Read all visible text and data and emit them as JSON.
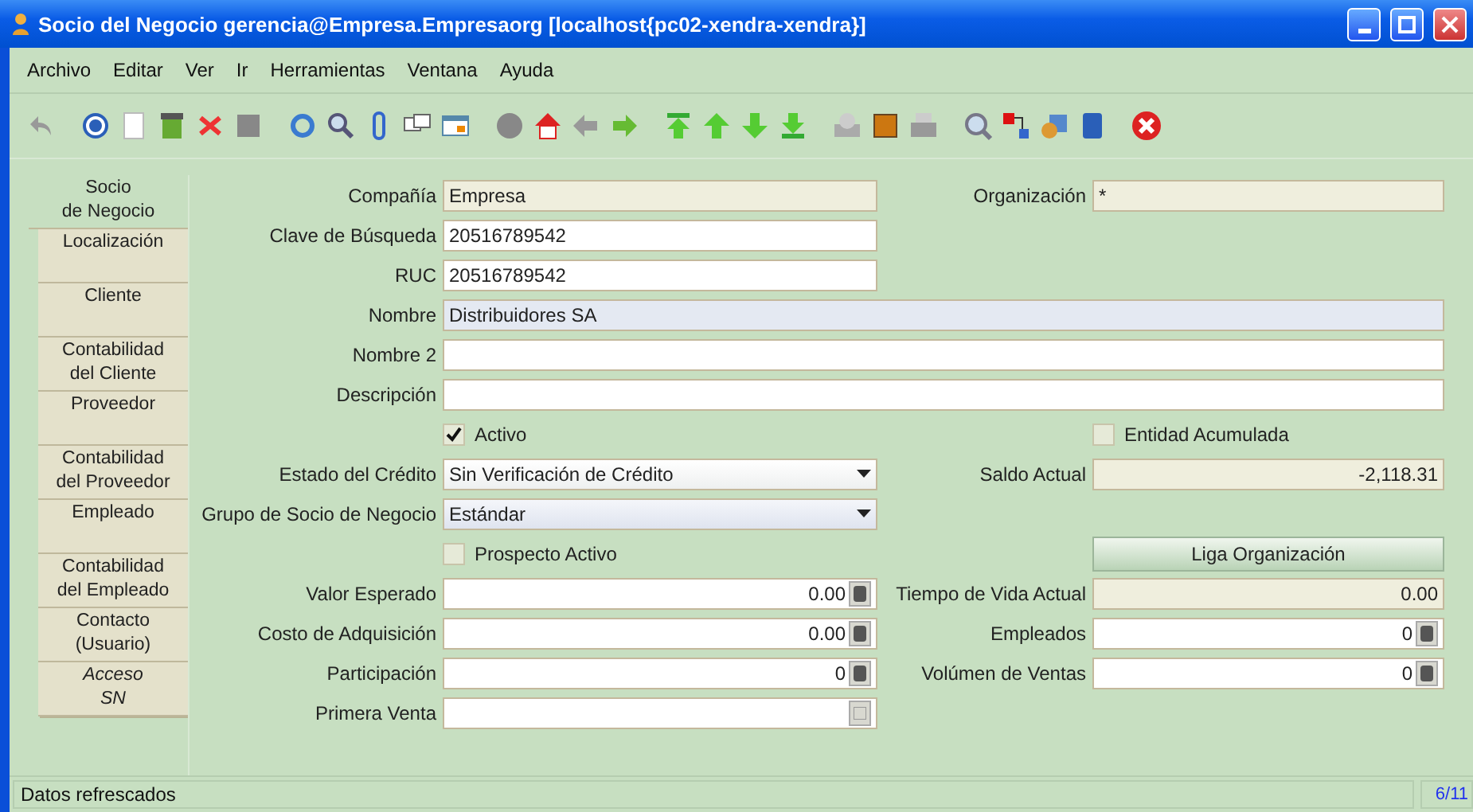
{
  "window": {
    "title": "Socio del Negocio  gerencia@Empresa.Empresaorg [localhost{pc02-xendra-xendra}]"
  },
  "menu": [
    "Archivo",
    "Editar",
    "Ver",
    "Ir",
    "Herramientas",
    "Ventana",
    "Ayuda"
  ],
  "tabs": [
    {
      "label": "Socio\nde Negocio",
      "selected": true,
      "disabled": false
    },
    {
      "label": "Localización",
      "selected": false,
      "disabled": false
    },
    {
      "label": "Cliente",
      "selected": false,
      "disabled": false
    },
    {
      "label": "Contabilidad\ndel Cliente",
      "selected": false,
      "disabled": false
    },
    {
      "label": "Proveedor",
      "selected": false,
      "disabled": false
    },
    {
      "label": "Contabilidad\ndel Proveedor",
      "selected": false,
      "disabled": false
    },
    {
      "label": "Empleado",
      "selected": false,
      "disabled": false
    },
    {
      "label": "Contabilidad\ndel Empleado",
      "selected": false,
      "disabled": false
    },
    {
      "label": "Contacto\n(Usuario)",
      "selected": false,
      "disabled": false
    },
    {
      "label": "Acceso\nSN",
      "selected": false,
      "disabled": true
    }
  ],
  "form": [
    {
      "left": {
        "kind": "readonly",
        "label": "Compañía",
        "value": "Empresa"
      },
      "right": {
        "kind": "readonly",
        "label": "Organización",
        "value": "*"
      }
    },
    {
      "left": {
        "kind": "text",
        "label": "Clave de Búsqueda",
        "value": "20516789542"
      }
    },
    {
      "left": {
        "kind": "text",
        "label": "RUC",
        "value": "20516789542"
      }
    },
    {
      "left": {
        "kind": "text",
        "label": "Nombre",
        "value": "Distribuidores SA",
        "mandatory": true,
        "full_width": true
      }
    },
    {
      "left": {
        "kind": "text",
        "label": "Nombre 2",
        "full_width": true
      }
    },
    {
      "left": {
        "kind": "text",
        "label": "Descripción",
        "full_width": true
      }
    },
    {
      "left": {
        "kind": "checkbox",
        "label": "Activo",
        "checked": true
      },
      "right": {
        "kind": "checkbox",
        "label": "Entidad Acumulada",
        "checked": false
      }
    },
    {
      "left": {
        "kind": "combo",
        "label": "Estado del Crédito",
        "value": "Sin Verificación de Crédito"
      },
      "right": {
        "kind": "readonly-number",
        "label": "Saldo Actual",
        "value": "-2,118.31"
      }
    },
    {
      "left": {
        "kind": "combo",
        "label": "Grupo de Socio de Negocio",
        "value": "Estándar",
        "mandatory": true
      }
    },
    {
      "left": {
        "kind": "checkbox",
        "label": "Prospecto Activo",
        "checked": false
      },
      "right": {
        "kind": "button",
        "label": "Liga Organización"
      }
    },
    {
      "left": {
        "kind": "number",
        "label": "Valor Esperado",
        "value": "0.00"
      },
      "right": {
        "kind": "readonly-number",
        "label": "Tiempo de Vida Actual",
        "value": "0.00"
      }
    },
    {
      "left": {
        "kind": "number",
        "label": "Costo de Adquisición",
        "value": "0.00"
      },
      "right": {
        "kind": "number",
        "label": "Empleados",
        "value": "0"
      }
    },
    {
      "left": {
        "kind": "number",
        "label": "Participación",
        "value": "0"
      },
      "right": {
        "kind": "number",
        "label": "Volúmen de Ventas",
        "value": "0"
      }
    },
    {
      "left": {
        "kind": "date",
        "label": "Primera Venta"
      }
    }
  ],
  "status_bar": {
    "message": "Datos refrescados",
    "record": "6/11"
  }
}
